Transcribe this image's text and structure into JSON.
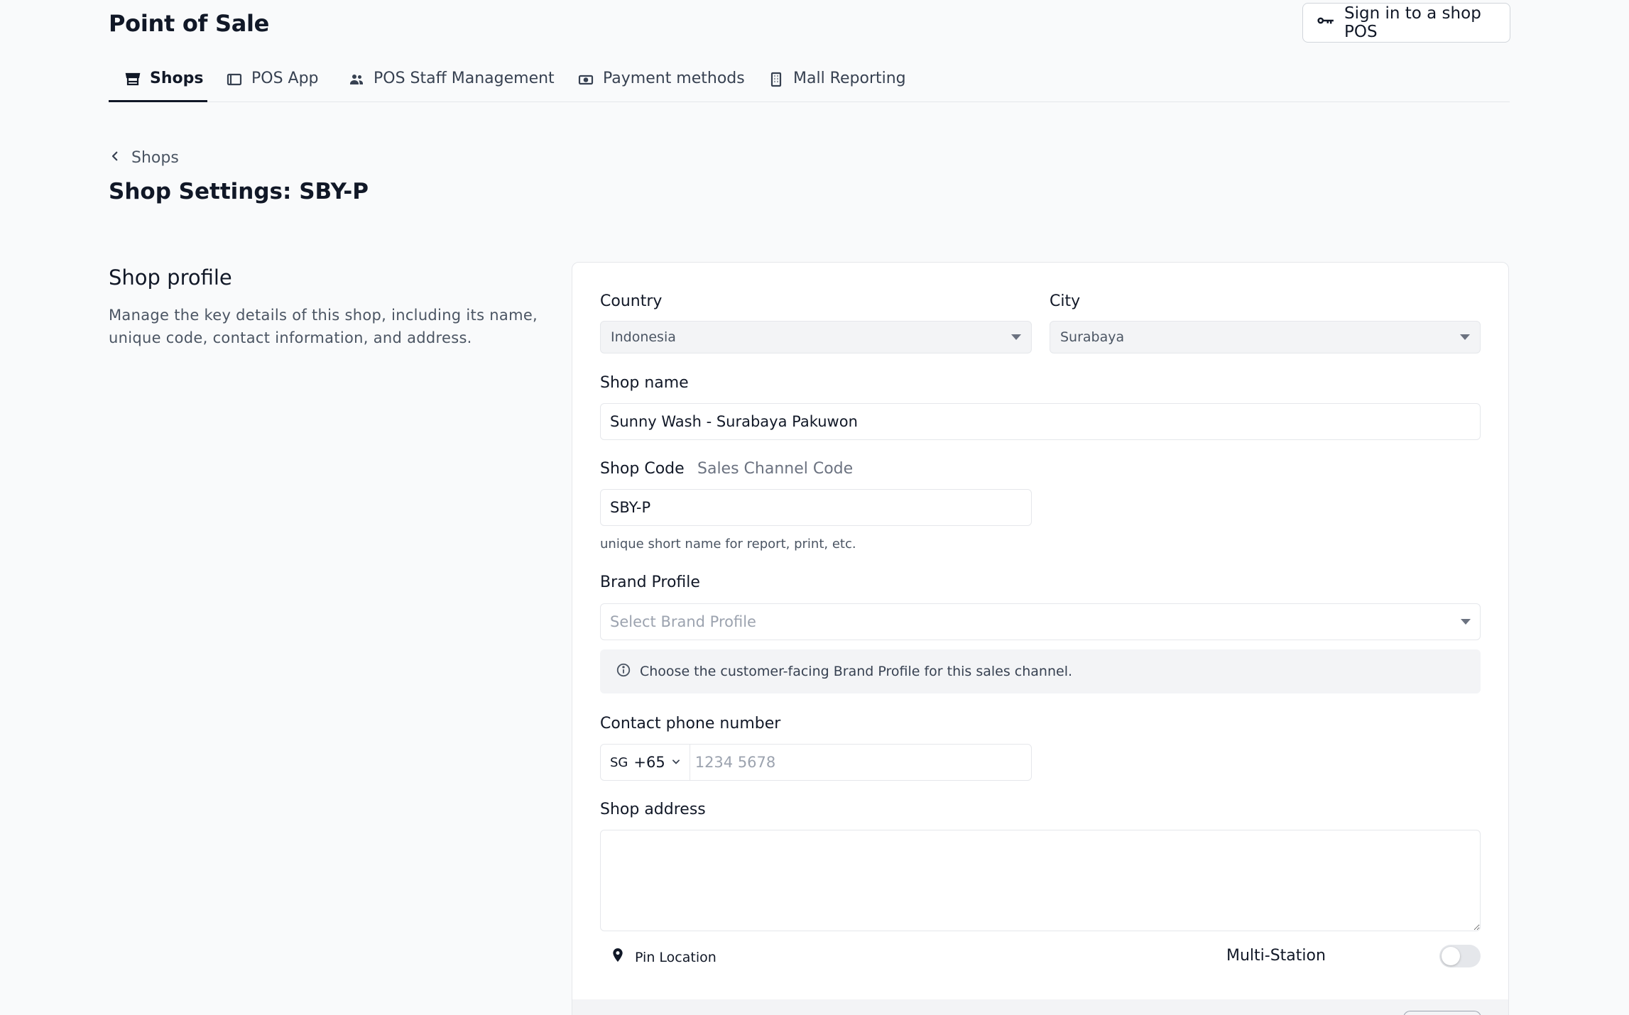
{
  "header": {
    "title": "Point of Sale",
    "signin_label": "Sign in to a shop POS",
    "signin_icon": "key-icon"
  },
  "tabs": [
    {
      "label": "Shops",
      "icon": "store-icon",
      "active": true
    },
    {
      "label": "POS App",
      "icon": "tablet-icon",
      "active": false
    },
    {
      "label": "POS Staff Management",
      "icon": "users-icon",
      "active": false
    },
    {
      "label": "Payment methods",
      "icon": "banknote-icon",
      "active": false
    },
    {
      "label": "Mall Reporting",
      "icon": "building-icon",
      "active": false
    }
  ],
  "breadcrumb": {
    "label": "Shops"
  },
  "page": {
    "title": "Shop Settings: SBY-P"
  },
  "section": {
    "title": "Shop profile",
    "description": "Manage the key details of this shop, including its name, unique code, contact information, and address."
  },
  "form": {
    "country": {
      "label": "Country",
      "value": "Indonesia"
    },
    "city": {
      "label": "City",
      "value": "Surabaya"
    },
    "shop_name": {
      "label": "Shop name",
      "value": "Sunny Wash - Surabaya Pakuwon"
    },
    "shop_code": {
      "label": "Shop Code",
      "alt_label": "Sales Channel Code",
      "value": "SBY-P",
      "helper": "unique short name for report, print, etc."
    },
    "brand_profile": {
      "label": "Brand Profile",
      "placeholder": "Select Brand Profile",
      "info": "Choose the customer-facing Brand Profile for this sales channel."
    },
    "phone": {
      "label": "Contact phone number",
      "country_iso": "SG",
      "dial_code": "+65",
      "placeholder": "1234 5678"
    },
    "address": {
      "label": "Shop address",
      "value": ""
    },
    "pin_location_label": "Pin Location",
    "multi_station": {
      "label": "Multi-Station",
      "enabled": false
    }
  },
  "colors": {
    "primary_text": "#111827",
    "muted_text": "#6b7280",
    "background": "#f9fafb",
    "border": "#e5e7eb"
  }
}
